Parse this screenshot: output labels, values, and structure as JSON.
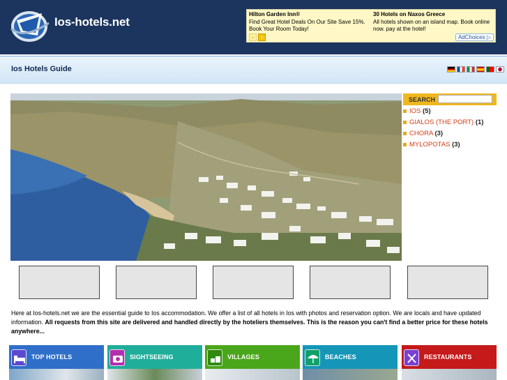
{
  "header": {
    "site_name": "Ios-hotels.net"
  },
  "ad": {
    "col1_title": "Hilton Garden Inn®",
    "col1_body": "Find Great Hotel Deals On Our Site Save 15%. Book Your Room Today!",
    "col2_title": "30 Hotels on Naxos Greece",
    "col2_body": "All hotels shown on an island map. Book online now. pay at the hotel!",
    "prev_glyph": "‹",
    "next_glyph": "›",
    "adchoices_label": "AdChoices ▷"
  },
  "title_bar": {
    "title": "Ios Hotels Guide",
    "flags": [
      "german-flag",
      "french-flag",
      "italian-flag",
      "spanish-flag",
      "portuguese-flag",
      "japanese-flag"
    ]
  },
  "search": {
    "label": "SEARCH",
    "input_value": "",
    "areas": [
      {
        "name": "IOS",
        "count": "(5)"
      },
      {
        "name": "GIALOS (THE PORT)",
        "count": "(1)"
      },
      {
        "name": "CHORA",
        "count": "(3)"
      },
      {
        "name": "MYLOPOTAS",
        "count": "(3)"
      }
    ]
  },
  "intro": {
    "text_plain": "Here at Ios-hotels.net we are the essential guide to Ios accommodation. We offer a list of all hotels in Ios with photos and reservation option. We are locals and have updated information. ",
    "text_bold": "All requests from this site are delivered and handled directly by the hoteliers themselves. This is the reason you can't find a better price for these hotels anywhere..."
  },
  "categories": [
    {
      "label": "TOP HOTELS",
      "icon": "bed-icon",
      "color": "#2f6fc9"
    },
    {
      "label": "SIGHTSEEING",
      "icon": "camera-icon",
      "color": "#8b2fc4"
    },
    {
      "label": "VILLAGES",
      "icon": "village-icon",
      "color": "#4aa61a"
    },
    {
      "label": "BEACHES",
      "icon": "umbrella-icon",
      "color": "#1596b8"
    },
    {
      "label": "RESTAURANTS",
      "icon": "cutlery-icon",
      "color": "#c41a1a"
    }
  ]
}
